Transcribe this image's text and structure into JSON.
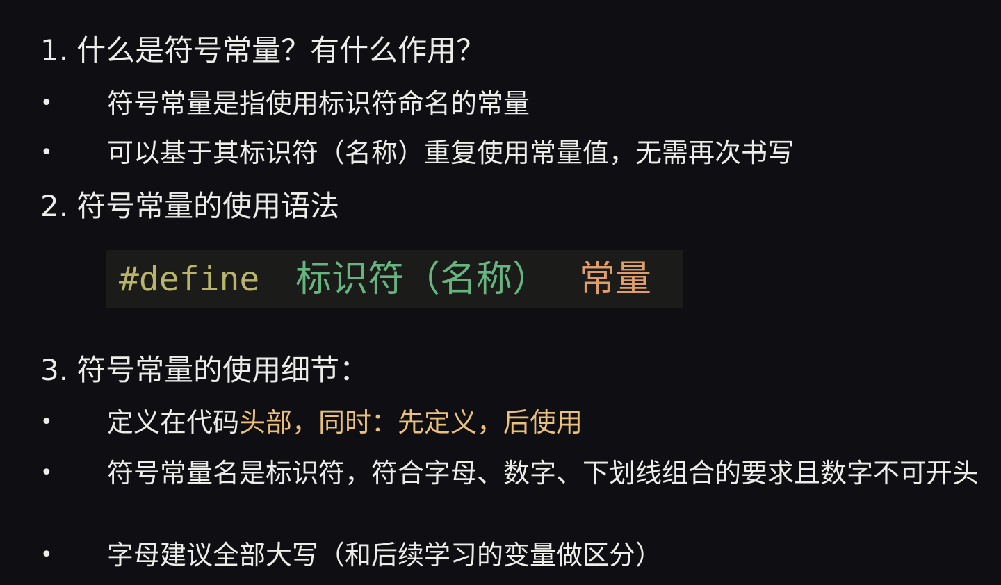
{
  "sections": [
    {
      "number": "1.",
      "title": "什么是符号常量？有什么作用？",
      "bullets": [
        {
          "text": "符号常量是指使用标识符命名的常量"
        },
        {
          "text": "可以基于其标识符（名称）重复使用常量值，无需再次书写"
        }
      ]
    },
    {
      "number": "2.",
      "title": "符号常量的使用语法",
      "code": {
        "keyword": "#define",
        "identifier": "标识符（名称）",
        "value": "常量",
        "colors": {
          "keyword": "#b8b56a",
          "identifier": "#66b580",
          "value": "#de9d6a",
          "background": "#1b1c19"
        }
      }
    },
    {
      "number": "3.",
      "title": "符号常量的使用细节：",
      "bullets": [
        {
          "text_plain": "定义在代码",
          "text_highlight": "头部，同时：先定义，后使用"
        },
        {
          "text": "符号常量名是标识符，符合字母、数字、下划线组合的要求且数字不可开头"
        },
        {
          "text": "字母建议全部大写（和后续学习的变量做区分）"
        }
      ]
    }
  ],
  "bullet_symbol": "•",
  "colors": {
    "background": "#0f0f13",
    "text": "#ecece8",
    "highlight": "#eac07a"
  }
}
